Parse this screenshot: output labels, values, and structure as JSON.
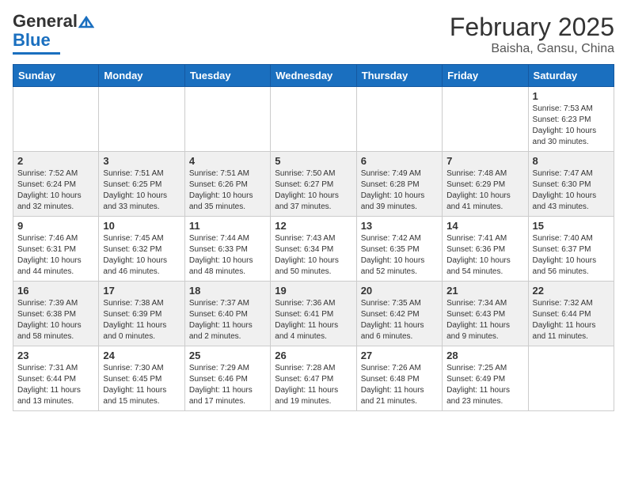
{
  "header": {
    "logo_general": "General",
    "logo_blue": "Blue",
    "title": "February 2025",
    "subtitle": "Baisha, Gansu, China"
  },
  "weekdays": [
    "Sunday",
    "Monday",
    "Tuesday",
    "Wednesday",
    "Thursday",
    "Friday",
    "Saturday"
  ],
  "weeks": [
    [
      {
        "day": "",
        "info": ""
      },
      {
        "day": "",
        "info": ""
      },
      {
        "day": "",
        "info": ""
      },
      {
        "day": "",
        "info": ""
      },
      {
        "day": "",
        "info": ""
      },
      {
        "day": "",
        "info": ""
      },
      {
        "day": "1",
        "info": "Sunrise: 7:53 AM\nSunset: 6:23 PM\nDaylight: 10 hours\nand 30 minutes."
      }
    ],
    [
      {
        "day": "2",
        "info": "Sunrise: 7:52 AM\nSunset: 6:24 PM\nDaylight: 10 hours\nand 32 minutes."
      },
      {
        "day": "3",
        "info": "Sunrise: 7:51 AM\nSunset: 6:25 PM\nDaylight: 10 hours\nand 33 minutes."
      },
      {
        "day": "4",
        "info": "Sunrise: 7:51 AM\nSunset: 6:26 PM\nDaylight: 10 hours\nand 35 minutes."
      },
      {
        "day": "5",
        "info": "Sunrise: 7:50 AM\nSunset: 6:27 PM\nDaylight: 10 hours\nand 37 minutes."
      },
      {
        "day": "6",
        "info": "Sunrise: 7:49 AM\nSunset: 6:28 PM\nDaylight: 10 hours\nand 39 minutes."
      },
      {
        "day": "7",
        "info": "Sunrise: 7:48 AM\nSunset: 6:29 PM\nDaylight: 10 hours\nand 41 minutes."
      },
      {
        "day": "8",
        "info": "Sunrise: 7:47 AM\nSunset: 6:30 PM\nDaylight: 10 hours\nand 43 minutes."
      }
    ],
    [
      {
        "day": "9",
        "info": "Sunrise: 7:46 AM\nSunset: 6:31 PM\nDaylight: 10 hours\nand 44 minutes."
      },
      {
        "day": "10",
        "info": "Sunrise: 7:45 AM\nSunset: 6:32 PM\nDaylight: 10 hours\nand 46 minutes."
      },
      {
        "day": "11",
        "info": "Sunrise: 7:44 AM\nSunset: 6:33 PM\nDaylight: 10 hours\nand 48 minutes."
      },
      {
        "day": "12",
        "info": "Sunrise: 7:43 AM\nSunset: 6:34 PM\nDaylight: 10 hours\nand 50 minutes."
      },
      {
        "day": "13",
        "info": "Sunrise: 7:42 AM\nSunset: 6:35 PM\nDaylight: 10 hours\nand 52 minutes."
      },
      {
        "day": "14",
        "info": "Sunrise: 7:41 AM\nSunset: 6:36 PM\nDaylight: 10 hours\nand 54 minutes."
      },
      {
        "day": "15",
        "info": "Sunrise: 7:40 AM\nSunset: 6:37 PM\nDaylight: 10 hours\nand 56 minutes."
      }
    ],
    [
      {
        "day": "16",
        "info": "Sunrise: 7:39 AM\nSunset: 6:38 PM\nDaylight: 10 hours\nand 58 minutes."
      },
      {
        "day": "17",
        "info": "Sunrise: 7:38 AM\nSunset: 6:39 PM\nDaylight: 11 hours\nand 0 minutes."
      },
      {
        "day": "18",
        "info": "Sunrise: 7:37 AM\nSunset: 6:40 PM\nDaylight: 11 hours\nand 2 minutes."
      },
      {
        "day": "19",
        "info": "Sunrise: 7:36 AM\nSunset: 6:41 PM\nDaylight: 11 hours\nand 4 minutes."
      },
      {
        "day": "20",
        "info": "Sunrise: 7:35 AM\nSunset: 6:42 PM\nDaylight: 11 hours\nand 6 minutes."
      },
      {
        "day": "21",
        "info": "Sunrise: 7:34 AM\nSunset: 6:43 PM\nDaylight: 11 hours\nand 9 minutes."
      },
      {
        "day": "22",
        "info": "Sunrise: 7:32 AM\nSunset: 6:44 PM\nDaylight: 11 hours\nand 11 minutes."
      }
    ],
    [
      {
        "day": "23",
        "info": "Sunrise: 7:31 AM\nSunset: 6:44 PM\nDaylight: 11 hours\nand 13 minutes."
      },
      {
        "day": "24",
        "info": "Sunrise: 7:30 AM\nSunset: 6:45 PM\nDaylight: 11 hours\nand 15 minutes."
      },
      {
        "day": "25",
        "info": "Sunrise: 7:29 AM\nSunset: 6:46 PM\nDaylight: 11 hours\nand 17 minutes."
      },
      {
        "day": "26",
        "info": "Sunrise: 7:28 AM\nSunset: 6:47 PM\nDaylight: 11 hours\nand 19 minutes."
      },
      {
        "day": "27",
        "info": "Sunrise: 7:26 AM\nSunset: 6:48 PM\nDaylight: 11 hours\nand 21 minutes."
      },
      {
        "day": "28",
        "info": "Sunrise: 7:25 AM\nSunset: 6:49 PM\nDaylight: 11 hours\nand 23 minutes."
      },
      {
        "day": "",
        "info": ""
      }
    ]
  ]
}
